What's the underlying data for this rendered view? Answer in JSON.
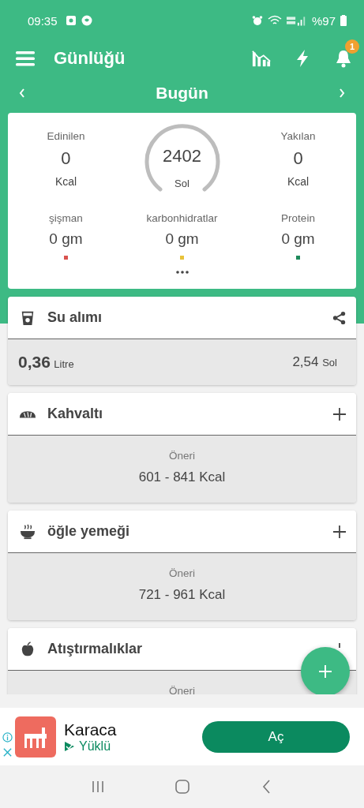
{
  "status_bar": {
    "time": "09:35",
    "battery": "%97"
  },
  "app_bar": {
    "title": "Günlüğü",
    "notification_count": "1"
  },
  "date_nav": {
    "label": "Bugün"
  },
  "summary": {
    "eaten": {
      "label": "Edinilen",
      "value": "0",
      "unit": "Kcal"
    },
    "remaining": {
      "value": "2402",
      "label": "Sol"
    },
    "burned": {
      "label": "Yakılan",
      "value": "0",
      "unit": "Kcal"
    },
    "macros": [
      {
        "label": "şişman",
        "value": "0 gm",
        "color": "#d9534f"
      },
      {
        "label": "karbonhidratlar",
        "value": "0 gm",
        "color": "#e8c23a"
      },
      {
        "label": "Protein",
        "value": "0 gm",
        "color": "#1f8a5b"
      }
    ]
  },
  "water": {
    "title": "Su alımı",
    "amount": "0,36",
    "unit": "Litre",
    "left_value": "2,54",
    "left_unit": "Sol"
  },
  "meals": [
    {
      "kind": "bread",
      "title": "Kahvaltı",
      "suggestion_label": "Öneri",
      "suggestion": "601 - 841 Kcal"
    },
    {
      "kind": "bowl",
      "title": "öğle yemeği",
      "suggestion_label": "Öneri",
      "suggestion": "721 - 961 Kcal"
    },
    {
      "kind": "apple",
      "title": "Atıştırmalıklar",
      "suggestion_label": "Öneri"
    }
  ],
  "ad": {
    "app_name": "Karaca",
    "status": "Yüklü",
    "button": "Aç"
  }
}
